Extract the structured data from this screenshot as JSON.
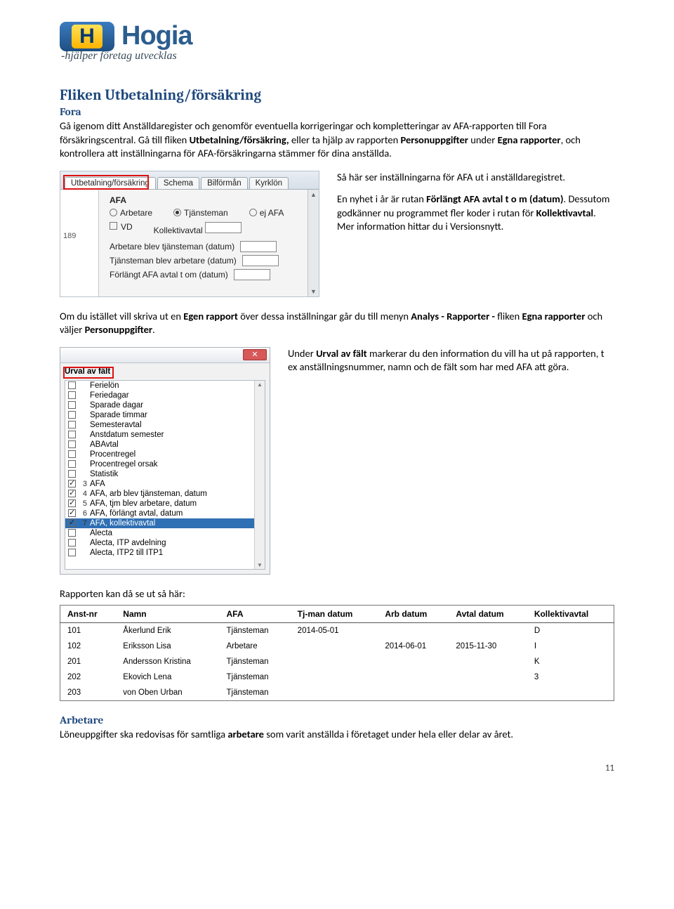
{
  "logo": {
    "brand": "Hogia",
    "tagline": "-hjälper företag utvecklas"
  },
  "section": {
    "title": "Fliken Utbetalning/försäkring",
    "fora_title": "Fora",
    "para1a": "Gå igenom ditt Anställdaregister och genomför eventuella korrigeringar och kompletteringar av AFA-rapporten till Fora försäkringscentral. Gå till fliken ",
    "para1b": "Utbetalning/försäkring,",
    "para1c": " eller ta hjälp av rapporten ",
    "para1d": "Personuppgifter",
    "para1e": " under ",
    "para1f": "Egna rapporter",
    "para1g": ", och kontrollera att inställningarna för AFA-försäkringarna stämmer för dina anställda.",
    "r1": "Så här ser inställningarna för AFA ut i anställdaregistret.",
    "r2a": "En nyhet i år är rutan ",
    "r2b": "Förlängt AFA avtal t o m (datum)",
    "r2c": ". Dessutom godkänner nu programmet fler koder i rutan för ",
    "r2d": "Kollektivavtal",
    "r2e": ". Mer information hittar du i Versionsnytt.",
    "para3a": "Om du istället vill skriva ut en ",
    "para3b": "Egen rapport",
    "para3c": " över dessa inställningar går du till menyn ",
    "para3d": "Analys - Rapporter - ",
    "para3e": "fliken ",
    "para3f": "Egna rapporter",
    "para3g": " och väljer ",
    "para3h": "Personuppgifter",
    "para3i": ".",
    "r4a": "Under ",
    "r4b": "Urval av fält",
    "r4c": " markerar du den information du vill ha ut på rapporten, t ex anställningsnummer, namn och de fält som har med AFA att göra.",
    "rapport_line": "Rapporten kan då se ut så här:",
    "arbetare_title": "Arbetare",
    "arbetare_a": "Löneuppgifter ska redovisas för samtliga ",
    "arbetare_b": "arbetare",
    "arbetare_c": " som varit anställda i företaget under hela eller delar av året."
  },
  "ui1": {
    "tabs": [
      "Utbetalning/försäkring",
      "Schema",
      "Bilförmån",
      "Kyrklön"
    ],
    "left_num": "189",
    "afa": "AFA",
    "radios": [
      "Arbetare",
      "Tjänsteman",
      "ej AFA"
    ],
    "checks": [
      "VD",
      "Kollektivavtal"
    ],
    "lines": [
      "Arbetare blev tjänsteman (datum)",
      "Tjänsteman blev arbetare (datum)",
      "Förlängt AFA avtal t om (datum)"
    ]
  },
  "ui2": {
    "title": "Urval av fält",
    "items": [
      {
        "c": false,
        "n": "",
        "t": "Ferielön"
      },
      {
        "c": false,
        "n": "",
        "t": "Feriedagar"
      },
      {
        "c": false,
        "n": "",
        "t": "Sparade dagar"
      },
      {
        "c": false,
        "n": "",
        "t": "Sparade timmar"
      },
      {
        "c": false,
        "n": "",
        "t": "Semesteravtal"
      },
      {
        "c": false,
        "n": "",
        "t": "Anstdatum semester"
      },
      {
        "c": false,
        "n": "",
        "t": "ABAvtal"
      },
      {
        "c": false,
        "n": "",
        "t": "Procentregel"
      },
      {
        "c": false,
        "n": "",
        "t": "Procentregel orsak"
      },
      {
        "c": false,
        "n": "",
        "t": "Statistik"
      },
      {
        "c": true,
        "n": "3",
        "t": "AFA"
      },
      {
        "c": true,
        "n": "4",
        "t": "AFA, arb blev tjänsteman, datum"
      },
      {
        "c": true,
        "n": "5",
        "t": "AFA, tjm blev arbetare, datum"
      },
      {
        "c": true,
        "n": "6",
        "t": "AFA, förlängt avtal, datum"
      },
      {
        "c": true,
        "n": "7",
        "t": "AFA, kollektivavtal",
        "sel": true
      },
      {
        "c": false,
        "n": "",
        "t": "Alecta"
      },
      {
        "c": false,
        "n": "",
        "t": "Alecta, ITP avdelning"
      },
      {
        "c": false,
        "n": "",
        "t": "Alecta, ITP2 till ITP1"
      }
    ]
  },
  "table": {
    "headers": [
      "Anst-nr",
      "Namn",
      "AFA",
      "Tj-man datum",
      "Arb datum",
      "Avtal datum",
      "Kollektivavtal"
    ],
    "rows": [
      [
        "101",
        "Åkerlund Erik",
        "Tjänsteman",
        "2014-05-01",
        "",
        "",
        "D"
      ],
      [
        "102",
        "Eriksson Lisa",
        "Arbetare",
        "",
        "2014-06-01",
        "2015-11-30",
        "I"
      ],
      [
        "201",
        "Andersson Kristina",
        "Tjänsteman",
        "",
        "",
        "",
        "K"
      ],
      [
        "202",
        "Ekovich Lena",
        "Tjänsteman",
        "",
        "",
        "",
        "3"
      ],
      [
        "203",
        "von Oben Urban",
        "Tjänsteman",
        "",
        "",
        "",
        ""
      ]
    ]
  },
  "page_number": "11"
}
